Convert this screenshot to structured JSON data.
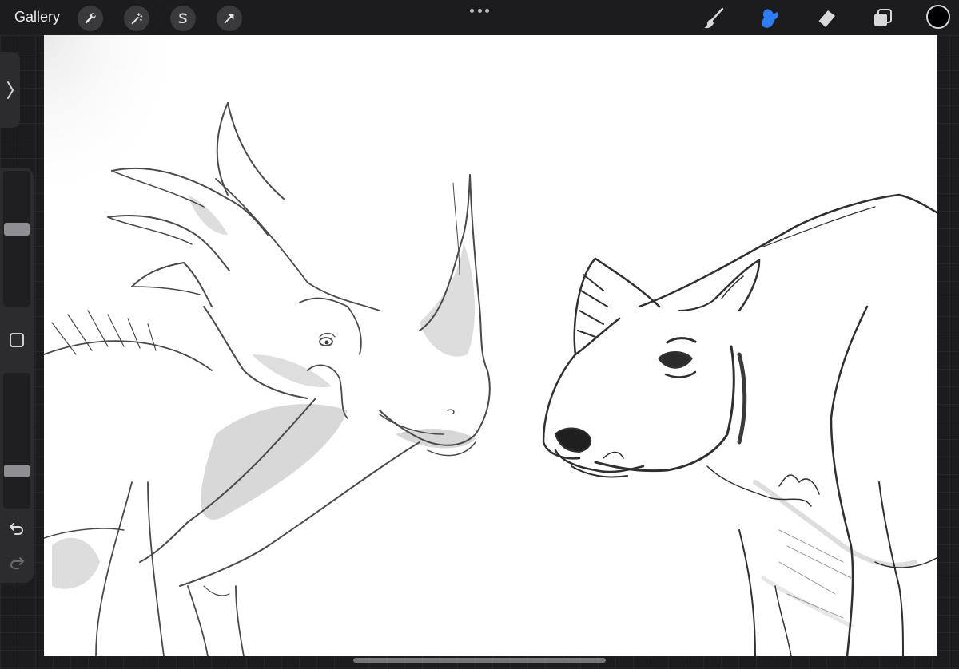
{
  "toolbar": {
    "gallery_label": "Gallery",
    "left_tools": [
      "wrench-icon",
      "magic-wand-icon",
      "selection-s-icon",
      "transform-arrow-icon"
    ],
    "right_tools": [
      "brush-icon",
      "smudge-icon",
      "eraser-icon",
      "layers-icon"
    ],
    "active_tool": "smudge-icon",
    "current_color": "#000000",
    "active_color": "#2e7cf6"
  },
  "sidebar": {
    "brush_size": 0.58,
    "opacity": 0.25
  }
}
